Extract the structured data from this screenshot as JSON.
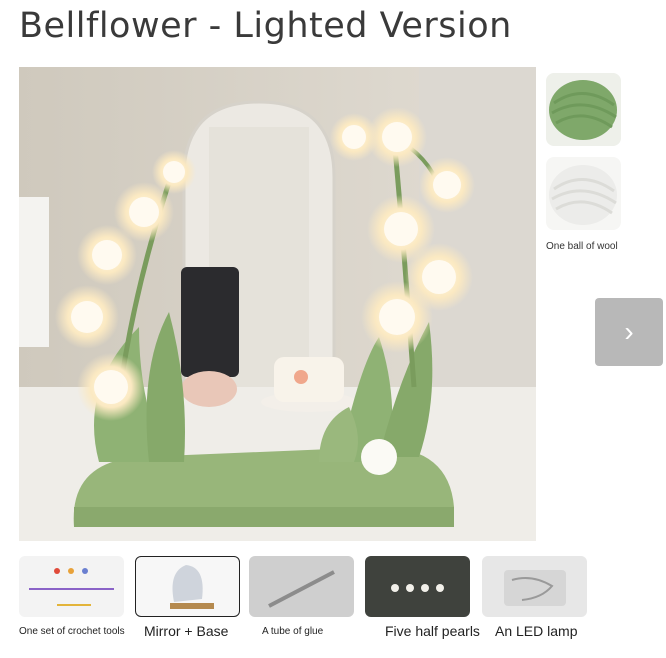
{
  "title": "Bellflower - Lighted Version",
  "side_thumbnails": [
    {
      "name": "green-wool",
      "color": "#7fa86a"
    },
    {
      "name": "white-wool",
      "color": "#f2f2f0",
      "caption": "One ball of wool"
    }
  ],
  "next_button": {
    "glyph": "›"
  },
  "strip": [
    {
      "label": "One set of crochet tools",
      "selected": false
    },
    {
      "label": "Mirror + Base",
      "selected": true
    },
    {
      "label": "A tube of glue",
      "selected": false
    },
    {
      "label": "Five half pearls",
      "selected": false
    },
    {
      "label": "An LED lamp",
      "selected": false
    }
  ],
  "colors": {
    "knit_green": "#98b67a",
    "glow": "#fff3d6",
    "button_gray": "#b8b8b8"
  }
}
